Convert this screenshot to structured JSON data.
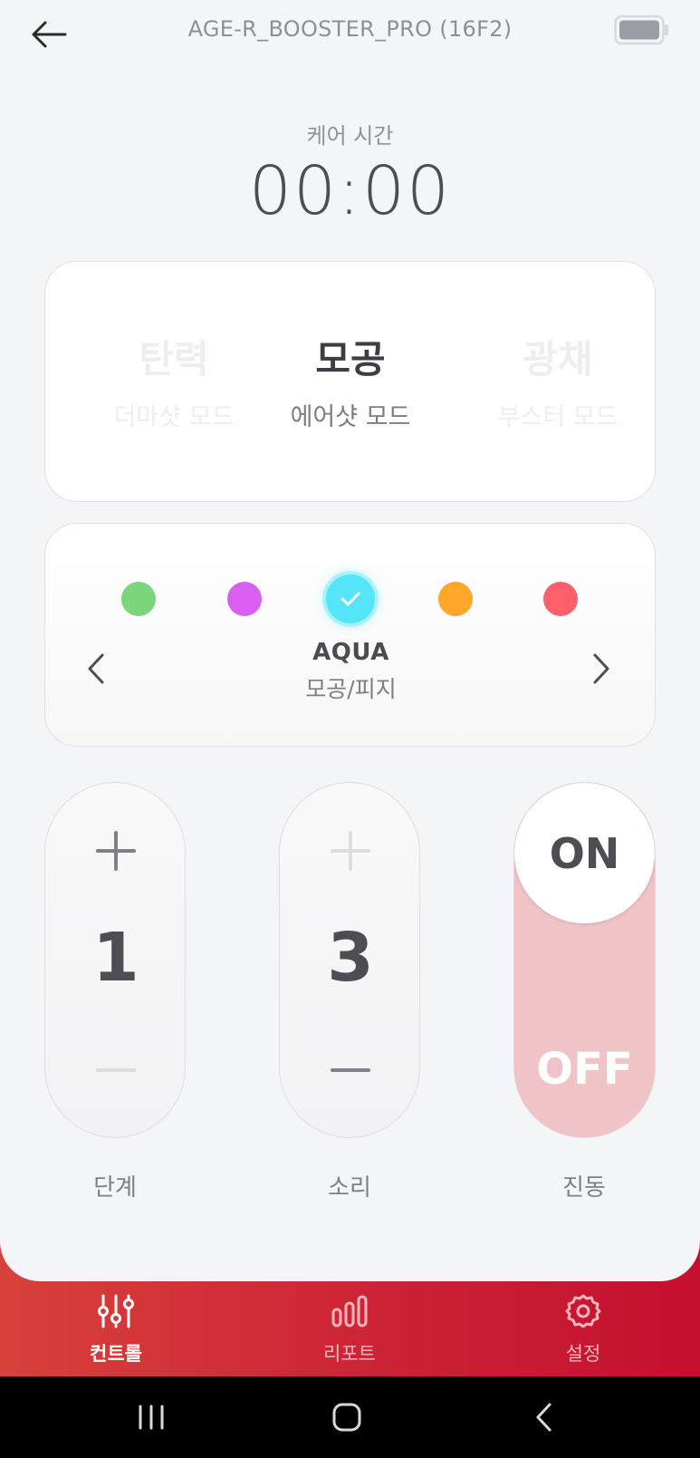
{
  "header": {
    "device_name": "AGE-R_BOOSTER_PRO (16F2)"
  },
  "care": {
    "label": "케어 시간",
    "time": "00:00"
  },
  "modes": {
    "items": [
      {
        "name": "탄력",
        "sub": "더마샷 모드",
        "state": "faded"
      },
      {
        "name": "모공",
        "sub": "에어샷 모드",
        "state": "selected"
      },
      {
        "name": "광채",
        "sub": "부스터 모드",
        "state": "faded"
      }
    ]
  },
  "colors": {
    "options": [
      {
        "icon": "green-dot",
        "color": "#7ad57b"
      },
      {
        "icon": "purple-dot",
        "color": "#d95ef2"
      },
      {
        "icon": "aqua-dot",
        "color": "#54e6f7",
        "selected": true
      },
      {
        "icon": "orange-dot",
        "color": "#ffa62b"
      },
      {
        "icon": "red-dot",
        "color": "#ff5f6b"
      }
    ],
    "selected_name": "AQUA",
    "selected_sub": "모공/피지"
  },
  "controls": {
    "level": {
      "value": "1",
      "label": "단계"
    },
    "sound": {
      "value": "3",
      "label": "소리"
    },
    "vibration": {
      "on_label": "ON",
      "off_label": "OFF",
      "label": "진동",
      "state": "on"
    }
  },
  "nav": {
    "items": [
      {
        "label": "컨트롤",
        "icon": "sliders-icon",
        "active": true
      },
      {
        "label": "리포트",
        "icon": "bar-chart-icon",
        "active": false
      },
      {
        "label": "설정",
        "icon": "gear-icon",
        "active": false
      }
    ]
  },
  "theme": {
    "accent_gradient": [
      "#d8413a",
      "#c5102f"
    ],
    "background": "#f4f5f9",
    "toggle_on": "#f0c3c7"
  }
}
